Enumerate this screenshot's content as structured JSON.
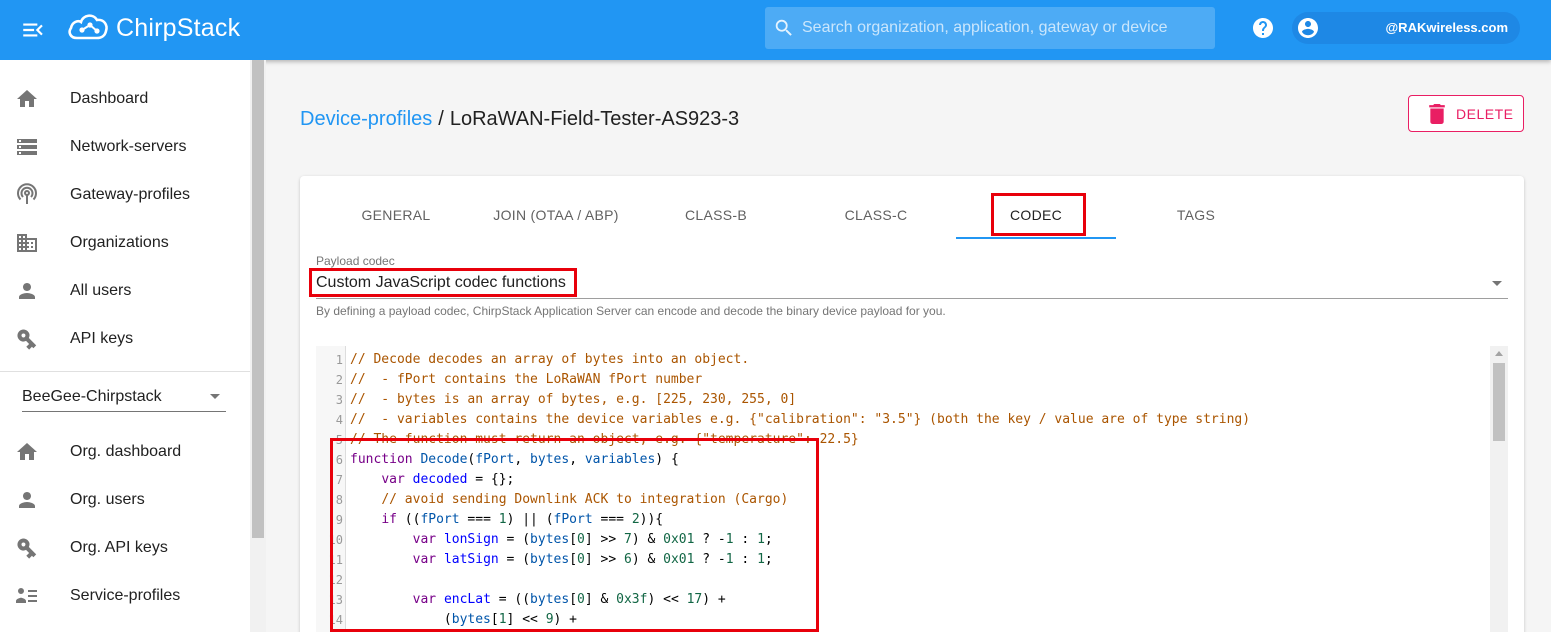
{
  "topbar": {
    "brand": "ChirpStack",
    "search_placeholder": "Search organization, application, gateway or device",
    "user_email": "@RAKwireless.com"
  },
  "sidebar": {
    "items": [
      {
        "label": "Dashboard",
        "icon": "home-icon"
      },
      {
        "label": "Network-servers",
        "icon": "server-icon"
      },
      {
        "label": "Gateway-profiles",
        "icon": "antenna-icon"
      },
      {
        "label": "Organizations",
        "icon": "domain-icon"
      },
      {
        "label": "All users",
        "icon": "person-icon"
      },
      {
        "label": "API keys",
        "icon": "key-icon"
      }
    ],
    "org_selector": "BeeGee-Chirpstack",
    "org_items": [
      {
        "label": "Org. dashboard",
        "icon": "home-icon"
      },
      {
        "label": "Org. users",
        "icon": "person-icon"
      },
      {
        "label": "Org. API keys",
        "icon": "key-icon"
      },
      {
        "label": "Service-profiles",
        "icon": "list-icon"
      }
    ]
  },
  "breadcrumb": {
    "parent": "Device-profiles",
    "separator": "/",
    "current": "LoRaWAN-Field-Tester-AS923-3"
  },
  "delete_label": "DELETE",
  "tabs": [
    {
      "label": "GENERAL"
    },
    {
      "label": "JOIN (OTAA / ABP)"
    },
    {
      "label": "CLASS-B"
    },
    {
      "label": "CLASS-C"
    },
    {
      "label": "CODEC",
      "active": true
    },
    {
      "label": "TAGS"
    }
  ],
  "payload_codec": {
    "label": "Payload codec",
    "value": "Custom JavaScript codec functions",
    "help": "By defining a payload codec, ChirpStack Application Server can encode and decode the binary device payload for you."
  },
  "code_lines": [
    "// Decode decodes an array of bytes into an object.",
    "//  - fPort contains the LoRaWAN fPort number",
    "//  - bytes is an array of bytes, e.g. [225, 230, 255, 0]",
    "//  - variables contains the device variables e.g. {\"calibration\": \"3.5\"} (both the key / value are of type string)",
    "// The function must return an object, e.g. {\"temperature\": 22.5}",
    "function Decode(fPort, bytes, variables) {",
    "    var decoded = {};",
    "    // avoid sending Downlink ACK to integration (Cargo)",
    "    if ((fPort === 1) || (fPort === 2)){",
    "        var lonSign = (bytes[0] >> 7) & 0x01 ? -1 : 1;",
    "        var latSign = (bytes[0] >> 6) & 0x01 ? -1 : 1;",
    "",
    "        var encLat = ((bytes[0] & 0x3f) << 17) +",
    "            (bytes[1] << 9) +"
  ],
  "colors": {
    "primary": "#2196f3",
    "delete": "#e91e63",
    "highlight": "#e8000b"
  }
}
